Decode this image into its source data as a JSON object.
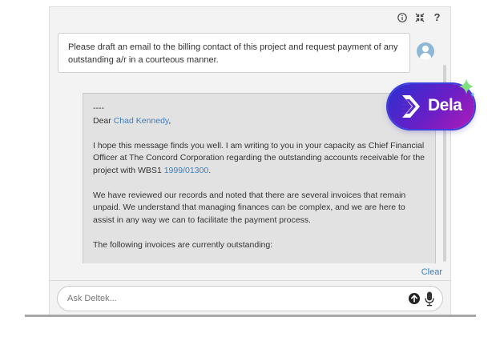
{
  "toolbar": {
    "info_icon": "info-icon",
    "expand_icon": "collapse-arrows-icon",
    "help_label": "?"
  },
  "user_message": {
    "text": "Please draft an email to the billing contact of this project and request payment of any outstanding a/r in a courteous manner.",
    "avatar_icon": "user-icon"
  },
  "reply": {
    "separator": "----",
    "greeting_prefix": "Dear ",
    "greeting_name": "Chad Kennedy",
    "greeting_suffix": ",",
    "p1_text": "I hope this message finds you well. I am writing to you in your capacity as Chief Financial Officer at The Concord Corporation regarding the outstanding accounts receivable for the project with WBS1 ",
    "p1_link": "1999/01300",
    "p1_end": ".",
    "p2": "We have reviewed our records and noted that there are several invoices that remain unpaid. We understand that managing finances can be complex, and we are here to assist in any way we can to facilitate the payment process.",
    "p3": "The following invoices are currently outstanding:"
  },
  "clear_label": "Clear",
  "ask": {
    "placeholder": "Ask Deltek...",
    "value": "",
    "send_icon": "send-arrow-icon",
    "mic_icon": "microphone-icon"
  },
  "badge": {
    "text": "Dela",
    "icon": "dela-logo-icon",
    "sparkle_icon": "sparkle-icon"
  },
  "colors": {
    "link": "#3d7fc1",
    "reply_bg": "#e2e2e2",
    "panel_bg": "#f3f3f3",
    "badge_start": "#2b2fd0",
    "badge_end": "#b01cb8",
    "sparkle": "#7ee07e"
  }
}
